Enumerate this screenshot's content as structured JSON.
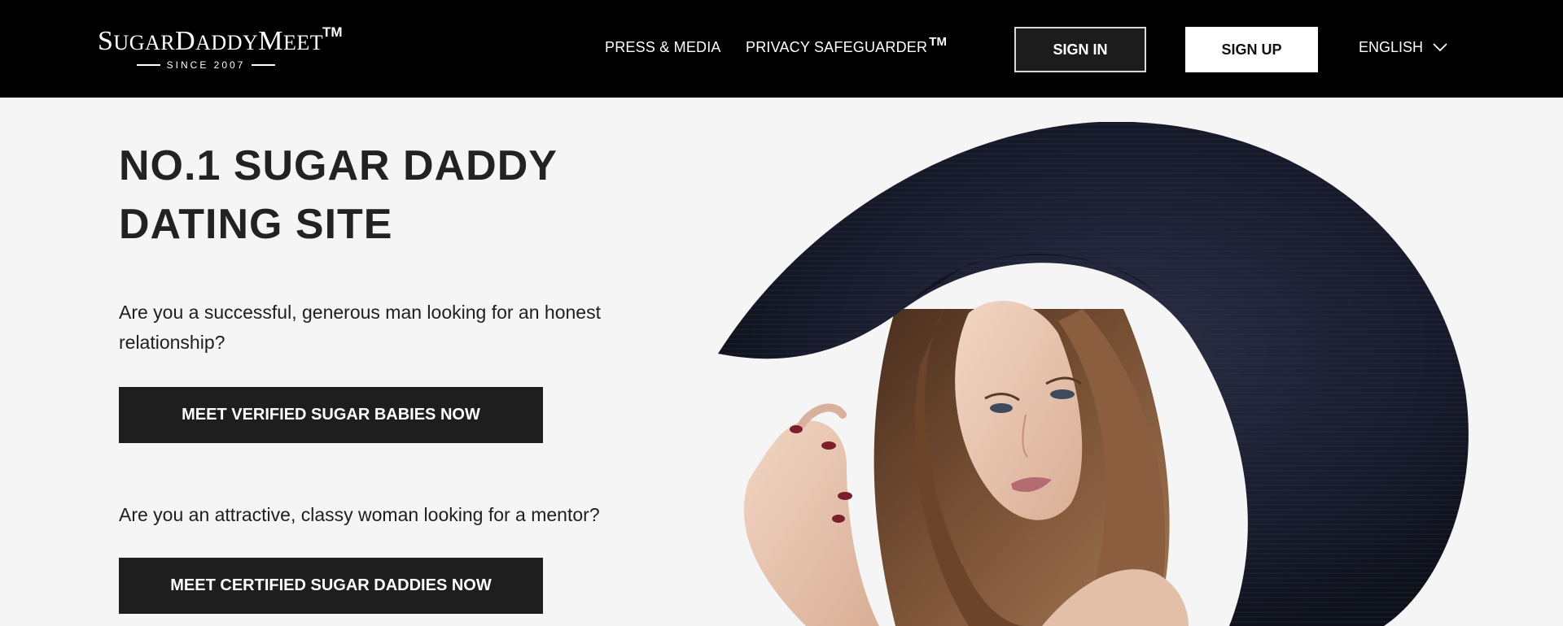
{
  "header": {
    "logo": {
      "name_parts": [
        {
          "cap": "S",
          "rest": "UGAR"
        },
        {
          "cap": "D",
          "rest": "ADDY"
        },
        {
          "cap": "M",
          "rest": "EET"
        }
      ],
      "trademark": "TM",
      "tagline": "SINCE 2007"
    },
    "nav": {
      "press_label": "PRESS & MEDIA",
      "privacy_label": "PRIVACY SAFEGUARDER",
      "privacy_tm": "TM"
    },
    "sign_in_label": "SIGN IN",
    "sign_up_label": "SIGN UP",
    "language": {
      "selected": "ENGLISH",
      "icon": "chevron-down-icon"
    }
  },
  "hero": {
    "title_line1": "NO.1 SUGAR DADDY",
    "title_line2": "DATING SITE",
    "question_men": "Are you a successful, generous man looking for an honest relationship?",
    "cta_men": "MEET VERIFIED SUGAR BABIES NOW",
    "question_women": "Are you an attractive, classy woman looking for a mentor?",
    "cta_women": "MEET CERTIFIED SUGAR DADDIES NOW"
  },
  "colors": {
    "header_bg": "#000000",
    "page_bg": "#f5f5f5",
    "button_dark": "#1e1e1e",
    "text_dark": "#222222"
  }
}
